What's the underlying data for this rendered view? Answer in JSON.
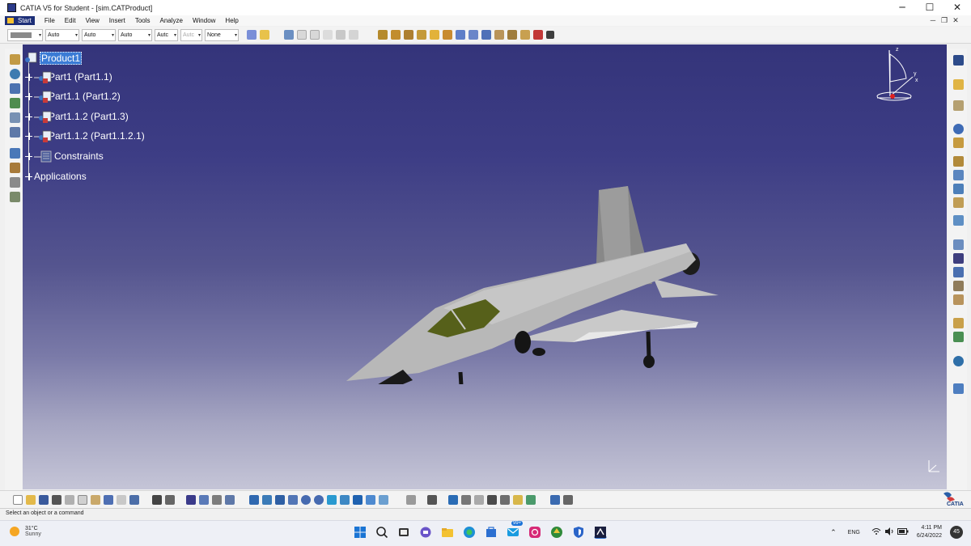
{
  "window": {
    "title": "CATIA V5 for Student - [sim.CATProduct]",
    "controls": {
      "minimize": "─",
      "maximize": "☐",
      "close": "✕"
    },
    "mdi_controls": {
      "minimize": "─",
      "restore": "❐",
      "close": "✕"
    }
  },
  "menu": {
    "start": "Start",
    "items": [
      "File",
      "Edit",
      "View",
      "Insert",
      "Tools",
      "Analyze",
      "Window",
      "Help"
    ]
  },
  "properties_toolbar": {
    "combos": [
      "Auto",
      "Auto",
      "Auto",
      "Autc",
      "Autc",
      "None"
    ],
    "arrow": "▾"
  },
  "spec_tree": {
    "root": "Product1",
    "children": [
      {
        "label": "Part1 (Part1.1)",
        "icon": "part-icon"
      },
      {
        "label": "Part1.1 (Part1.2)",
        "icon": "part-icon"
      },
      {
        "label": "Part1.1.2 (Part1.3)",
        "icon": "part-icon"
      },
      {
        "label": "Part1.1.2 (Part1.1.2.1)",
        "icon": "part-icon"
      },
      {
        "label": "Constraints",
        "icon": "constraints-icon"
      },
      {
        "label": "Applications",
        "icon": "none"
      }
    ]
  },
  "compass": {
    "x": "x",
    "y": "y",
    "z": "z"
  },
  "status": {
    "message": "Select an object or a command"
  },
  "brand": {
    "logo_text": "CATIA"
  },
  "taskbar": {
    "weather_temp": "31°C",
    "weather_desc": "Sunny",
    "badge": "99+",
    "language": "ENG",
    "time": "4:11 PM",
    "date": "6/24/2022",
    "notifications": "45"
  },
  "colors": {
    "viewport_top": "#34347a",
    "viewport_bottom": "#c5c5d7",
    "aircraft_body": "#bdbdbd",
    "canopy": "#5c6419",
    "selection": "#3a7bd5"
  }
}
